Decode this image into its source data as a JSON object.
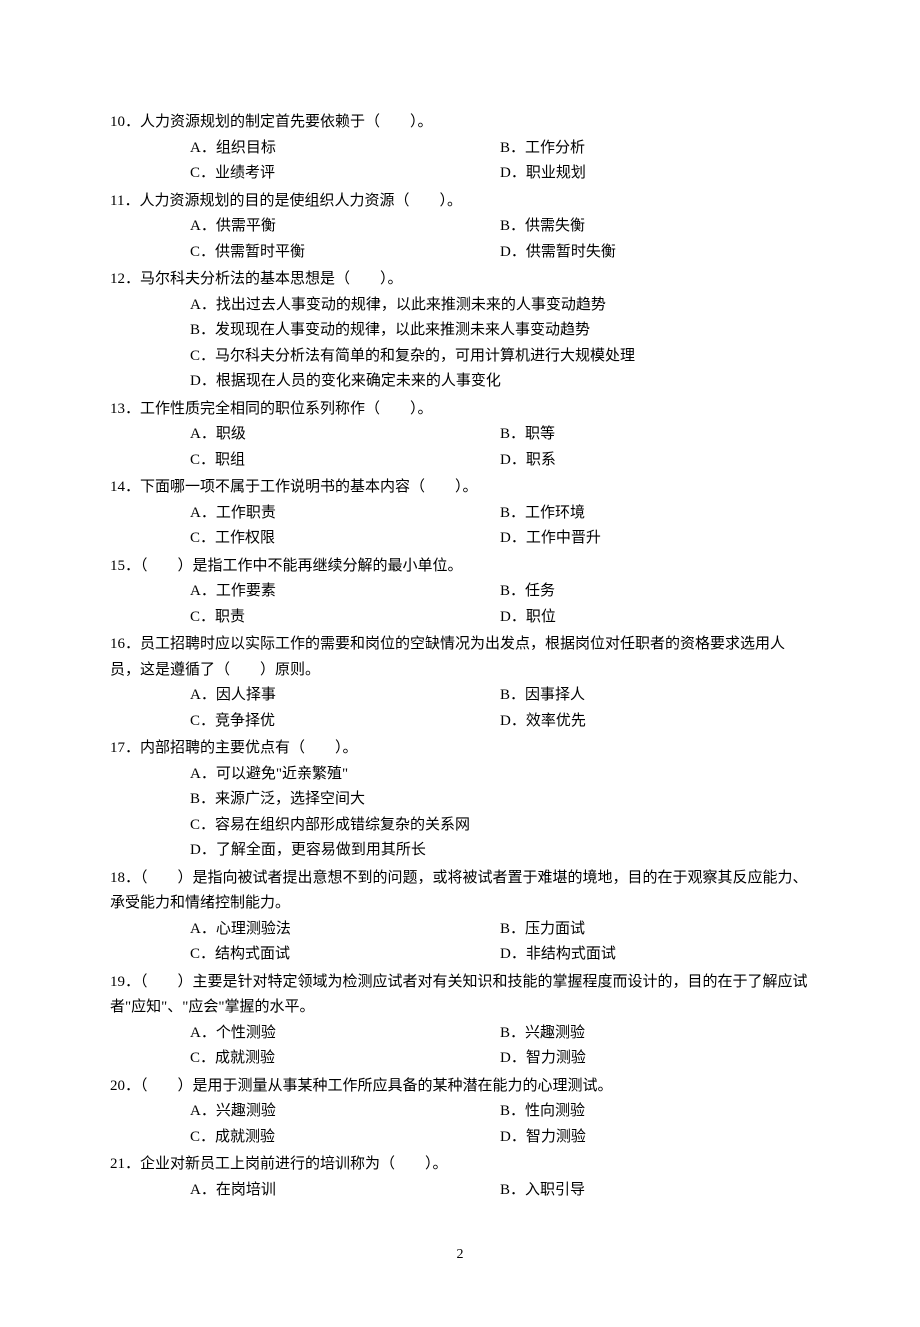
{
  "questions": [
    {
      "num": "10",
      "text": "10．人力资源规划的制定首先要依赖于（　　）。",
      "layout": "2col",
      "options": {
        "a": "A．组织目标",
        "b": "B．工作分析",
        "c": "C．业绩考评",
        "d": "D．职业规划"
      }
    },
    {
      "num": "11",
      "text": "11．人力资源规划的目的是使组织人力资源（　　）。",
      "layout": "2col",
      "options": {
        "a": "A．供需平衡",
        "b": "B．供需失衡",
        "c": "C．供需暂时平衡",
        "d": "D．供需暂时失衡"
      }
    },
    {
      "num": "12",
      "text": "12．马尔科夫分析法的基本思想是（　　）。",
      "layout": "1col-indent",
      "options": {
        "a": "A．找出过去人事变动的规律，以此来推测未来的人事变动趋势",
        "b": "B．发现现在人事变动的规律，以此来推测未来人事变动趋势",
        "c": "C．马尔科夫分析法有简单的和复杂的，可用计算机进行大规模处理",
        "d": "D．根据现在人员的变化来确定未来的人事变化"
      }
    },
    {
      "num": "13",
      "text": "13．工作性质完全相同的职位系列称作（　　）。",
      "layout": "2col",
      "options": {
        "a": "A．职级",
        "b": "B．职等",
        "c": "C．职组",
        "d": "D．职系"
      }
    },
    {
      "num": "14",
      "text": "14．下面哪一项不属于工作说明书的基本内容（　　）。",
      "layout": "2col",
      "options": {
        "a": "A．工作职责",
        "b": "B．工作环境",
        "c": "C．工作权限",
        "d": "D．工作中晋升"
      }
    },
    {
      "num": "15",
      "text": "15．（　　）是指工作中不能再继续分解的最小单位。",
      "layout": "2col",
      "options": {
        "a": "A．工作要素",
        "b": "B．任务",
        "c": "C．职责",
        "d": "D．职位"
      }
    },
    {
      "num": "16",
      "text": "16．员工招聘时应以实际工作的需要和岗位的空缺情况为出发点，根据岗位对任职者的资格要求选用人员，这是遵循了（　　）原则。",
      "layout": "2col-wide",
      "options": {
        "a": "A．因人择事",
        "b": "B．因事择人",
        "c": "C．竞争择优",
        "d": "D．效率优先"
      }
    },
    {
      "num": "17",
      "text": "17．内部招聘的主要优点有（　　）。",
      "layout": "1col",
      "options": {
        "a": "A．可以避免\"近亲繁殖\"",
        "b": "B．来源广泛，选择空间大",
        "c": "C．容易在组织内部形成错综复杂的关系网",
        "d": "D．了解全面，更容易做到用其所长"
      }
    },
    {
      "num": "18",
      "text": "18．（　　）是指向被试者提出意想不到的问题，或将被试者置于难堪的境地，目的在于观察其反应能力、承受能力和情绪控制能力。",
      "layout": "2col-wide",
      "options": {
        "a": "A．心理测验法",
        "b": "B．压力面试",
        "c": "C．结构式面试",
        "d": "D．非结构式面试"
      }
    },
    {
      "num": "19",
      "text": "19．（　　）主要是针对特定领域为检测应试者对有关知识和技能的掌握程度而设计的，目的在于了解应试者\"应知\"、\"应会\"掌握的水平。",
      "layout": "2col-wide",
      "options": {
        "a": "A．个性测验",
        "b": "B．兴趣测验",
        "c": "C．成就测验",
        "d": "D．智力测验"
      }
    },
    {
      "num": "20",
      "text": "20．（　　）是用于测量从事某种工作所应具备的某种潜在能力的心理测试。",
      "layout": "2col-wide",
      "options": {
        "a": "A．兴趣测验",
        "b": "B．性向测验",
        "c": "C．成就测验",
        "d": "D．智力测验"
      }
    },
    {
      "num": "21",
      "text": "21．企业对新员工上岗前进行的培训称为（　　）。",
      "layout": "2col",
      "options": {
        "a": "A．在岗培训",
        "b": "B．入职引导"
      }
    }
  ],
  "pageNumber": "2"
}
